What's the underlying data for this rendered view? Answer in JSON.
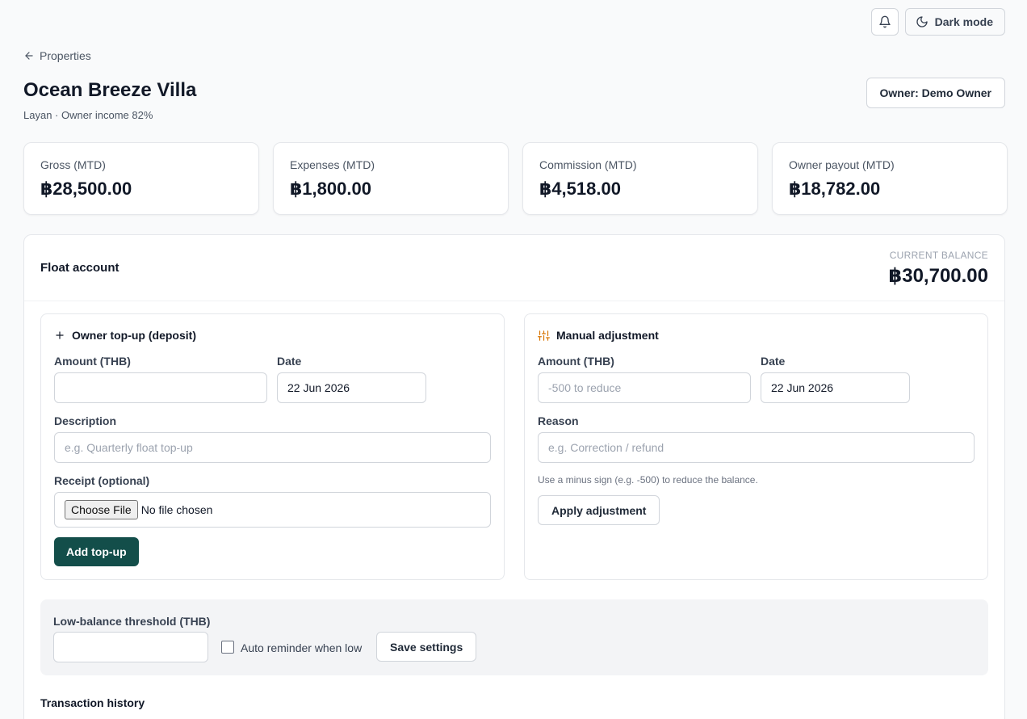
{
  "header": {
    "notifications_icon": "bell-icon",
    "dark_mode_label": "Dark mode",
    "dark_mode_icon": "moon-icon"
  },
  "breadcrumb": {
    "back_label": "Properties",
    "back_icon": "arrow-left-icon"
  },
  "property": {
    "name": "Ocean Breeze Villa",
    "subtitle": "Layan · Owner income 82%",
    "owner_button": "Owner: Demo Owner"
  },
  "stats": [
    {
      "label": "Gross (MTD)",
      "value": "฿28,500.00"
    },
    {
      "label": "Expenses (MTD)",
      "value": "฿1,800.00"
    },
    {
      "label": "Commission (MTD)",
      "value": "฿4,518.00"
    },
    {
      "label": "Owner payout (MTD)",
      "value": "฿18,782.00"
    }
  ],
  "float_account": {
    "title": "Float account",
    "balance_label": "CURRENT BALANCE",
    "balance_value": "฿30,700.00",
    "topup": {
      "title": "Owner top-up (deposit)",
      "icon": "plus-icon",
      "amount_label": "Amount (THB)",
      "amount_value": "",
      "date_label": "Date",
      "date_value": "22 Jun 2026",
      "description_label": "Description",
      "description_placeholder": "e.g. Quarterly float top-up",
      "receipt_label": "Receipt (optional)",
      "file_button": "Choose File",
      "file_status": "No file chosen",
      "submit_label": "Add top-up"
    },
    "adjustment": {
      "title": "Manual adjustment",
      "icon": "sliders-icon",
      "accent_color": "#d97706",
      "amount_label": "Amount (THB)",
      "amount_placeholder": "-500 to reduce",
      "date_label": "Date",
      "date_value": "22 Jun 2026",
      "reason_label": "Reason",
      "reason_placeholder": "e.g. Correction / refund",
      "hint": "Use a minus sign (e.g. -500) to reduce the balance.",
      "submit_label": "Apply adjustment"
    },
    "settings": {
      "threshold_label": "Low-balance threshold (THB)",
      "threshold_value": "",
      "auto_reminder_label": "Auto reminder when low",
      "auto_reminder_checked": false,
      "save_label": "Save settings"
    },
    "transactions_title": "Transaction history"
  },
  "colors": {
    "primary": "#134e4a",
    "background": "#f9fafb"
  }
}
